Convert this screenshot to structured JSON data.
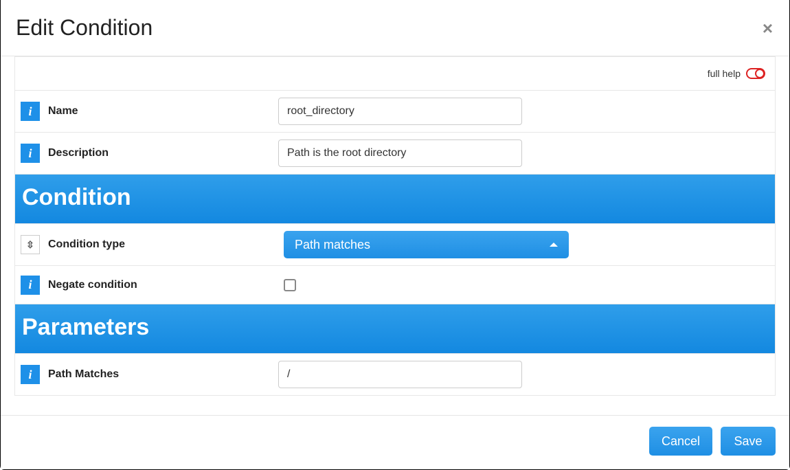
{
  "modal": {
    "title": "Edit Condition",
    "close_glyph": "×",
    "help": {
      "label": "full help",
      "on": false
    }
  },
  "fields": {
    "name": {
      "label": "Name",
      "value": "root_directory"
    },
    "description": {
      "label": "Description",
      "value": "Path is the root directory"
    },
    "condition_type": {
      "label": "Condition type",
      "selected": "Path matches"
    },
    "negate": {
      "label": "Negate condition",
      "checked": false
    },
    "path_matches": {
      "label": "Path Matches",
      "value": "/"
    }
  },
  "sections": {
    "condition": "Condition",
    "parameters": "Parameters"
  },
  "footer": {
    "cancel": "Cancel",
    "save": "Save"
  },
  "icons": {
    "info_glyph": "i",
    "alt_glyph": "⇳"
  }
}
